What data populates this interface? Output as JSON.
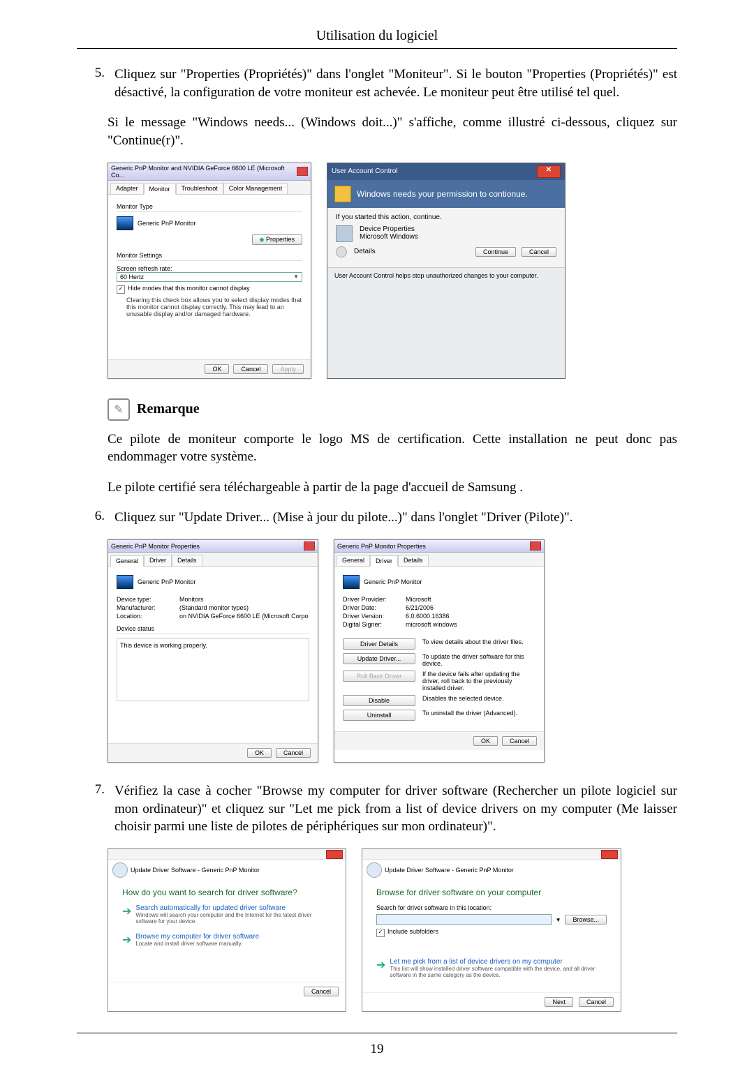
{
  "header_title": "Utilisation du logiciel",
  "page_number": "19",
  "step5": {
    "num": "5.",
    "text": "Cliquez sur \"Properties (Propriétés)\" dans l'onglet \"Moniteur\". Si le bouton \"Properties (Propriétés)\" est désactivé, la configuration de votre moniteur est achevée. Le moniteur peut être utilisé tel quel."
  },
  "para_uac": "Si le message \"Windows needs... (Windows doit...)\" s'affiche, comme illustré ci-dessous, cliquez sur \"Continue(r)\".",
  "note": {
    "label": "Remarque"
  },
  "note_p1": "Ce pilote de moniteur comporte le logo MS de certification. Cette installation ne peut donc pas endommager votre système.",
  "note_p2": "Le pilote certifié sera téléchargeable à partir de la page d'accueil de Samsung .",
  "step6": {
    "num": "6.",
    "text": "Cliquez sur \"Update Driver... (Mise à jour du pilote...)\" dans l'onglet \"Driver (Pilote)\"."
  },
  "step7": {
    "num": "7.",
    "text": "Vérifiez la case à cocher \"Browse my computer for driver software (Rechercher un pilote logiciel sur mon ordinateur)\" et cliquez sur \"Let me pick from a list of device drivers on my computer (Me laisser choisir parmi une liste de pilotes de périphériques sur mon ordinateur)\"."
  },
  "dlgA": {
    "title": "Generic PnP Monitor and NVIDIA GeForce 6600 LE (Microsoft Co...",
    "tab_adapter": "Adapter",
    "tab_monitor": "Monitor",
    "tab_troubleshoot": "Troubleshoot",
    "tab_color": "Color Management",
    "monitor_type": "Monitor Type",
    "monitor_name": "Generic PnP Monitor",
    "properties_btn": "Properties",
    "monitor_settings": "Monitor Settings",
    "refresh_label": "Screen refresh rate:",
    "refresh_value": "60 Hertz",
    "hide_label": "Hide modes that this monitor cannot display",
    "hide_desc": "Clearing this check box allows you to select display modes that this monitor cannot display correctly. This may lead to an unusable display and/or damaged hardware.",
    "ok": "OK",
    "cancel": "Cancel",
    "apply": "Apply"
  },
  "uac": {
    "title": "User Account Control",
    "banner": "Windows needs your permission to contionue.",
    "started": "If you started this action, continue.",
    "prog_name": "Device Properties",
    "prog_pub": "Microsoft Windows",
    "details": "Details",
    "continue": "Continue",
    "cancel": "Cancel",
    "footer": "User Account Control helps stop unauthorized changes to your computer."
  },
  "propsGeneral": {
    "title": "Generic PnP Monitor Properties",
    "tab_general": "General",
    "tab_driver": "Driver",
    "tab_details": "Details",
    "device_name": "Generic PnP Monitor",
    "device_type_k": "Device type:",
    "device_type_v": "Monitors",
    "mfr_k": "Manufacturer:",
    "mfr_v": "(Standard monitor types)",
    "loc_k": "Location:",
    "loc_v": "on NVIDIA GeForce 6600 LE (Microsoft Corpo",
    "status_label": "Device status",
    "status_text": "This device is working properly.",
    "ok": "OK",
    "cancel": "Cancel"
  },
  "propsDriver": {
    "title": "Generic PnP Monitor Properties",
    "tab_general": "General",
    "tab_driver": "Driver",
    "tab_details": "Details",
    "device_name": "Generic PnP Monitor",
    "provider_k": "Driver Provider:",
    "provider_v": "Microsoft",
    "date_k": "Driver Date:",
    "date_v": "6/21/2006",
    "ver_k": "Driver Version:",
    "ver_v": "6.0.6000.16386",
    "signer_k": "Digital Signer:",
    "signer_v": "microsoft windows",
    "btn_details": "Driver Details",
    "desc_details": "To view details about the driver files.",
    "btn_update": "Update Driver...",
    "desc_update": "To update the driver software for this device.",
    "btn_rollback": "Roll Back Driver",
    "desc_rollback": "If the device fails after updating the driver, roll back to the previously installed driver.",
    "btn_disable": "Disable",
    "desc_disable": "Disables the selected device.",
    "btn_uninstall": "Uninstall",
    "desc_uninstall": "To uninstall the driver (Advanced).",
    "ok": "OK",
    "cancel": "Cancel"
  },
  "wiz1": {
    "bc": "Update Driver Software - Generic PnP Monitor",
    "head": "How do you want to search for driver software?",
    "opt1_t": "Search automatically for updated driver software",
    "opt1_d": "Windows will search your computer and the Internet for the latest driver software for your device.",
    "opt2_t": "Browse my computer for driver software",
    "opt2_d": "Locate and install driver software manually.",
    "cancel": "Cancel"
  },
  "wiz2": {
    "bc": "Update Driver Software - Generic PnP Monitor",
    "head": "Browse for driver software on your computer",
    "search_label": "Search for driver software in this location:",
    "browse": "Browse...",
    "include": "Include subfolders",
    "opt_t": "Let me pick from a list of device drivers on my computer",
    "opt_d": "This list will show installed driver software compatible with the device, and all driver software in the same category as the device.",
    "next": "Next",
    "cancel": "Cancel"
  }
}
